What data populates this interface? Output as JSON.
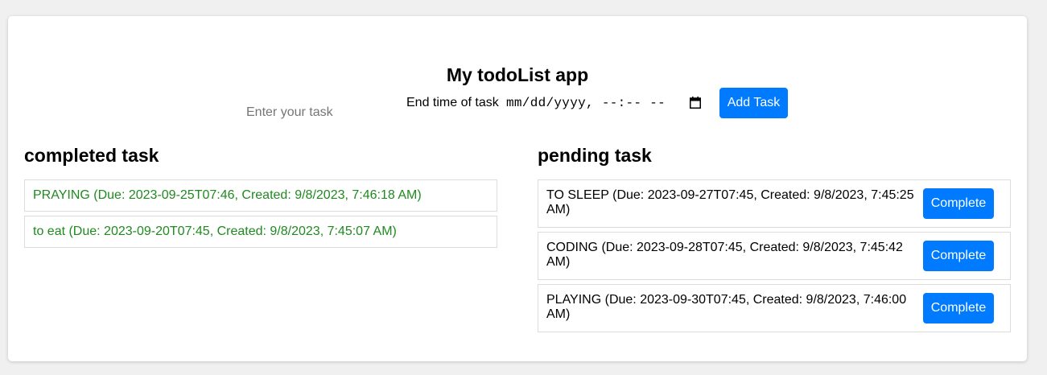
{
  "app": {
    "title": "My todoList app"
  },
  "form": {
    "task_placeholder": "Enter your task",
    "end_time_label": "End time of task",
    "date_value": "mm/dd/yyyy, --:-- --",
    "add_button": "Add Task"
  },
  "completed": {
    "heading": "completed task",
    "items": [
      "PRAYING (Due: 2023-09-25T07:46, Created: 9/8/2023, 7:46:18 AM)",
      "to eat (Due: 2023-09-20T07:45, Created: 9/8/2023, 7:45:07 AM)"
    ]
  },
  "pending": {
    "heading": "pending task",
    "button_label": "Complete",
    "items": [
      "TO SLEEP (Due: 2023-09-27T07:45, Created: 9/8/2023, 7:45:25 AM)",
      "CODING (Due: 2023-09-28T07:45, Created: 9/8/2023, 7:45:42 AM)",
      "PLAYING (Due: 2023-09-30T07:45, Created: 9/8/2023, 7:46:00 AM)"
    ]
  },
  "colors": {
    "primary": "#007bff",
    "completed_text": "#1f8a1f",
    "background": "#f0f0f0",
    "card": "#ffffff"
  },
  "icons": {
    "date_picker": "calendar-icon"
  }
}
